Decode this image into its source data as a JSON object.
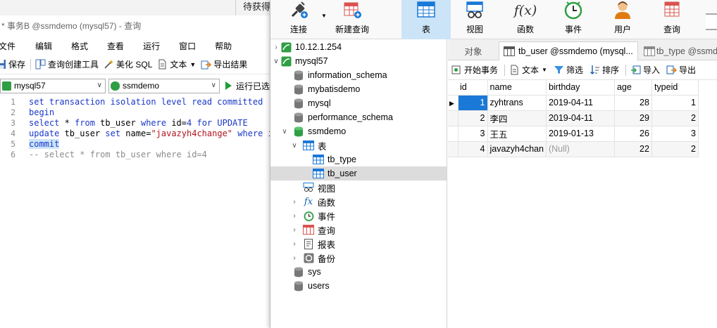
{
  "left_window": {
    "pending_label": "待获得",
    "title": "* 事务B @ssmdemo (mysql57) - 查询",
    "menu": [
      "文件",
      "编辑",
      "格式",
      "查看",
      "运行",
      "窗口",
      "帮助"
    ],
    "toolbar": {
      "save": "保存",
      "query_builder": "查询创建工具",
      "beautify": "美化 SQL",
      "text": "文本",
      "export": "导出结果"
    },
    "connection": "mysql57",
    "database": "ssmdemo",
    "run_label": "运行已选"
  },
  "editor": {
    "line_numbers": [
      "1",
      "2",
      "3",
      "4",
      "5",
      "6"
    ]
  },
  "ribbon": {
    "connect": "连接",
    "new_query": "新建查询",
    "table": "表",
    "view": "视图",
    "function": "函数",
    "event": "事件",
    "user": "用户",
    "query": "查询",
    "fx_glyph": "f(x)"
  },
  "nav": {
    "ip_conn": "10.12.1.254",
    "mysql_conn": "mysql57",
    "dbs": [
      "information_schema",
      "mybatisdemo",
      "mysql",
      "performance_schema"
    ],
    "open_db": "ssmdemo",
    "tables_group": "表",
    "tables": [
      "tb_type",
      "tb_user"
    ],
    "groups": [
      "视图",
      "函数",
      "事件",
      "查询",
      "报表",
      "备份"
    ],
    "bottom_dbs": [
      "sys",
      "users"
    ]
  },
  "tabs": {
    "objects": "对象",
    "tb_user_tab": "tb_user @ssmdemo (mysql...",
    "tb_type_tab": "tb_type @ssmd"
  },
  "subtoolbar": {
    "begin_tx": "开始事务",
    "text": "文本",
    "filter": "筛选",
    "sort": "排序",
    "import": "导入",
    "export": "导出"
  },
  "grid": {
    "columns": [
      "id",
      "name",
      "birthday",
      "age",
      "typeid"
    ],
    "rows": [
      {
        "id": "1",
        "name": "zyhtrans",
        "birthday": "2019-04-11",
        "age": "28",
        "typeid": "1"
      },
      {
        "id": "2",
        "name": "李四",
        "birthday": "2019-04-11",
        "age": "29",
        "typeid": "2"
      },
      {
        "id": "3",
        "name": "王五",
        "birthday": "2019-01-13",
        "age": "26",
        "typeid": "3"
      },
      {
        "id": "4",
        "name": "javazyh4chan",
        "birthday": "(Null)",
        "age": "22",
        "typeid": "2"
      }
    ]
  },
  "colors": {
    "accent": "#1a78d7",
    "keyword": "#1a38c9",
    "string": "#b0141e",
    "active_ribbon": "#cce4f7",
    "db_green": "#2f9e44"
  }
}
